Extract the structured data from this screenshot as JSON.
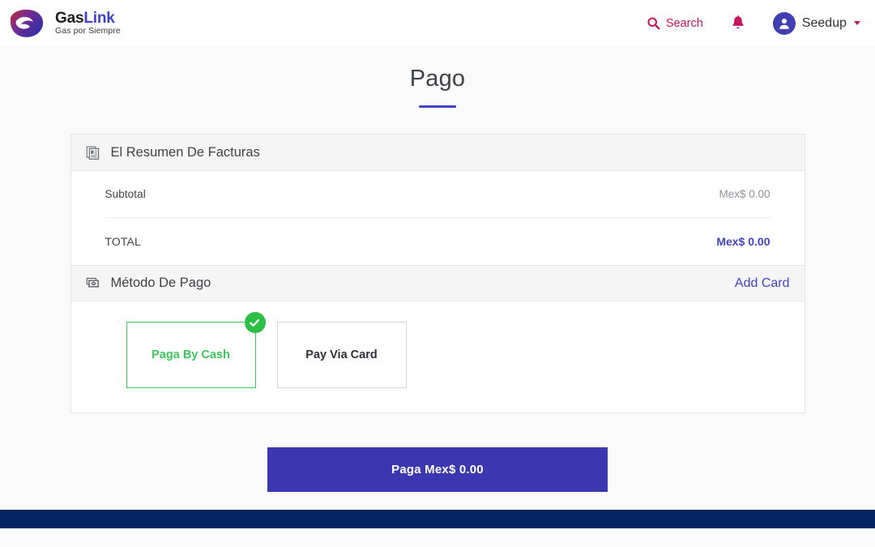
{
  "header": {
    "brand": {
      "name_part1": "Gas",
      "name_part2": "Link",
      "tagline": "Gas por Siempre",
      "logo_icon": "gaslink-swoosh-logo"
    },
    "search_label": "Search",
    "search_icon": "search-icon",
    "notifications_icon": "bell-icon",
    "user_name": "Seedup",
    "avatar_icon": "user-avatar-icon",
    "caret_icon": "chevron-down-icon",
    "accent_color": "#c2185b",
    "avatar_color": "#3f3fb0"
  },
  "page": {
    "title": "Pago",
    "title_rule_color": "#4343c6"
  },
  "invoice_summary": {
    "header_title": "El Resumen De Facturas",
    "header_icon": "invoice-document-icon",
    "rows": [
      {
        "label": "Subtotal",
        "value": "Mex$ 0.00"
      },
      {
        "label": "TOTAL",
        "value": "Mex$ 0.00"
      }
    ]
  },
  "payment_method": {
    "header_title": "Método De Pago",
    "header_icon": "banknote-stack-icon",
    "add_card_label": "Add Card",
    "add_card_color": "#4343c6",
    "options": [
      {
        "label": "Paga By Cash",
        "selected": true,
        "check_icon": "check-circle-icon"
      },
      {
        "label": "Pay Via Card",
        "selected": false
      }
    ],
    "selected_color": "#3ec75a"
  },
  "actions": {
    "pay_button_label": "Paga Mex$ 0.00",
    "pay_button_color": "#3b37b0"
  },
  "footer": {
    "color": "#04245f"
  }
}
